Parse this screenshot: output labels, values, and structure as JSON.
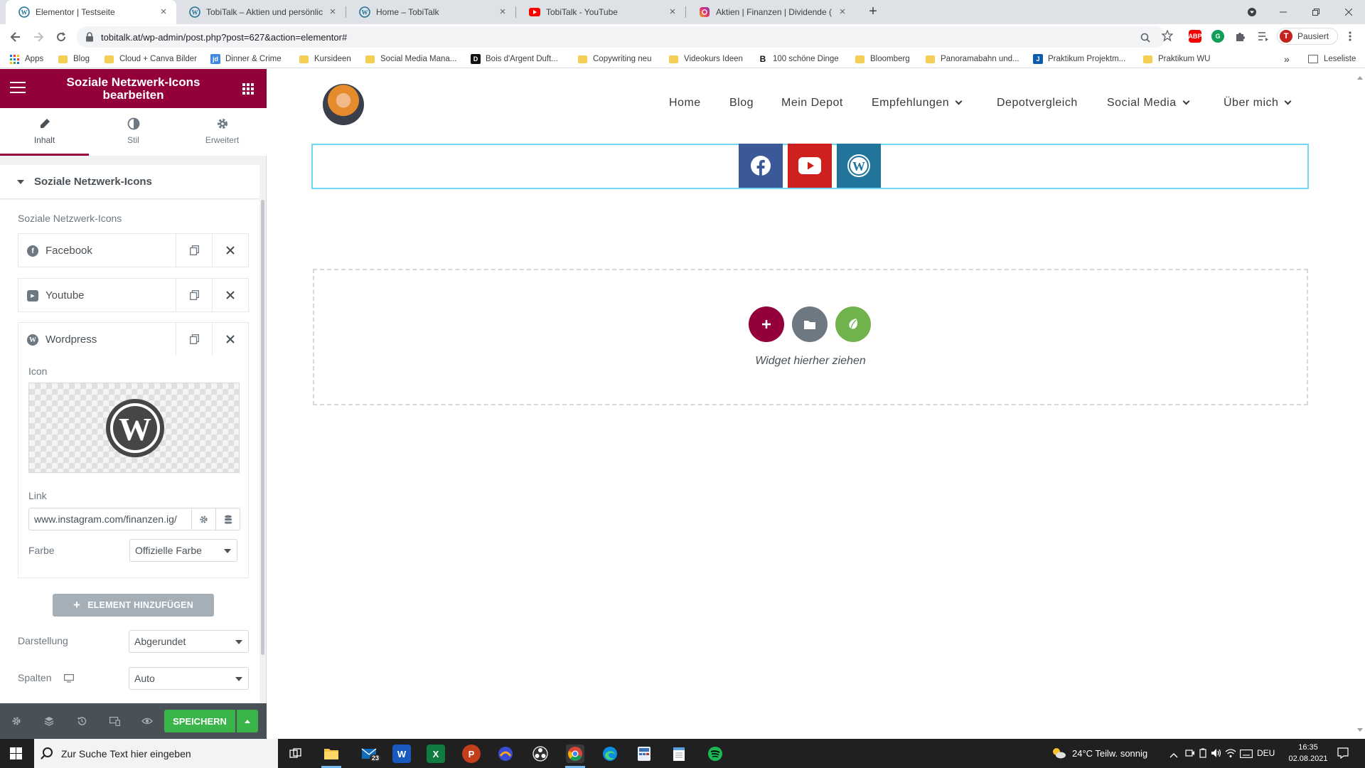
{
  "browser": {
    "tabs": [
      {
        "title": "Elementor | Testseite",
        "icon": "wordpress-icon",
        "active": true
      },
      {
        "title": "TobiTalk – Aktien und persönliche",
        "icon": "wordpress-icon",
        "active": false
      },
      {
        "title": "Home – TobiTalk",
        "icon": "wordpress-icon",
        "active": false
      },
      {
        "title": "TobiTalk - YouTube",
        "icon": "youtube-icon",
        "active": false
      },
      {
        "title": "Aktien | Finanzen | Dividende (@",
        "icon": "instagram-icon",
        "active": false
      }
    ],
    "url": "tobitalk.at/wp-admin/post.php?post=627&action=elementor#",
    "profile_label": "Pausiert",
    "profile_initial": "T",
    "ext_abp": "ABP",
    "ext_g": "G",
    "bookmarks": [
      {
        "label": "Apps",
        "kind": "apps"
      },
      {
        "label": "Blog",
        "kind": "folder"
      },
      {
        "label": "Cloud + Canva Bilder",
        "kind": "folder"
      },
      {
        "label": "Dinner & Crime",
        "kind": "site",
        "glyph": "jd",
        "color": "#3f8ae0"
      },
      {
        "label": "Kursideen",
        "kind": "folder"
      },
      {
        "label": "Social Media Mana...",
        "kind": "folder"
      },
      {
        "label": "Bois d'Argent Duft...",
        "kind": "site",
        "glyph": "D",
        "color": "#111111"
      },
      {
        "label": "Copywriting neu",
        "kind": "folder"
      },
      {
        "label": "Videokurs Ideen",
        "kind": "folder"
      },
      {
        "label": "100 schöne Dinge",
        "kind": "site",
        "glyph": "B",
        "color": "#ffffff"
      },
      {
        "label": "Bloomberg",
        "kind": "folder"
      },
      {
        "label": "Panoramabahn und...",
        "kind": "folder"
      },
      {
        "label": "Praktikum Projektm...",
        "kind": "site",
        "glyph": "J",
        "color": "#0b5cad"
      },
      {
        "label": "Praktikum WU",
        "kind": "folder"
      }
    ],
    "more_bookmarks": "»",
    "reading_list": "Leseliste"
  },
  "panel": {
    "title": "Soziale Netzwerk-Icons bearbeiten",
    "tabs": [
      {
        "label": "Inhalt",
        "icon": "pencil-icon",
        "active": true
      },
      {
        "label": "Stil",
        "icon": "half-circle-icon",
        "active": false
      },
      {
        "label": "Erweitert",
        "icon": "gear-icon",
        "active": false
      }
    ],
    "section_title": "Soziale Netzwerk-Icons",
    "repeater_label": "Soziale Netzwerk-Icons",
    "items": [
      {
        "title": "Facebook",
        "icon": "facebook-icon",
        "glyph": "f"
      },
      {
        "title": "Youtube",
        "icon": "youtube-icon",
        "glyph": "▶"
      },
      {
        "title": "Wordpress",
        "icon": "wordpress-icon",
        "glyph": "W"
      }
    ],
    "icon_label": "Icon",
    "link_label": "Link",
    "link_value": "www.instagram.com/finanzen.ig/",
    "color_label": "Farbe",
    "color_value": "Offizielle Farbe",
    "add_button": "ELEMENT HINZUFÜGEN",
    "display_label": "Darstellung",
    "display_value": "Abgerundet",
    "columns_label": "Spalten",
    "columns_value": "Auto",
    "save_button": "SPEICHERN"
  },
  "site": {
    "nav": [
      {
        "label": "Home",
        "dropdown": false
      },
      {
        "label": "Blog",
        "dropdown": false
      },
      {
        "label": "Mein Depot",
        "dropdown": false
      },
      {
        "label": "Empfehlungen",
        "dropdown": true
      },
      {
        "label": "Depotvergleich",
        "dropdown": false
      },
      {
        "label": "Social Media",
        "dropdown": true
      },
      {
        "label": "Über mich",
        "dropdown": true
      }
    ],
    "social_icons": [
      {
        "name": "facebook-icon",
        "color": "#3b5998"
      },
      {
        "name": "youtube-icon",
        "color": "#cd201f"
      },
      {
        "name": "wordpress-icon",
        "color": "#21759b"
      }
    ],
    "drop_zone_text": "Widget hierher ziehen",
    "drop_zone_colors": {
      "add": "#93003c",
      "template": "#6d7882",
      "kit": "#70b34c"
    }
  },
  "taskbar": {
    "search_placeholder": "Zur Suche Text hier eingeben",
    "mail_badge": "23",
    "weather": "24°C  Teilw. sonnig",
    "language": "DEU",
    "time": "16:35",
    "date": "02.08.2021"
  },
  "colors": {
    "elementor_accent": "#93003c",
    "save_green": "#39b54a"
  }
}
